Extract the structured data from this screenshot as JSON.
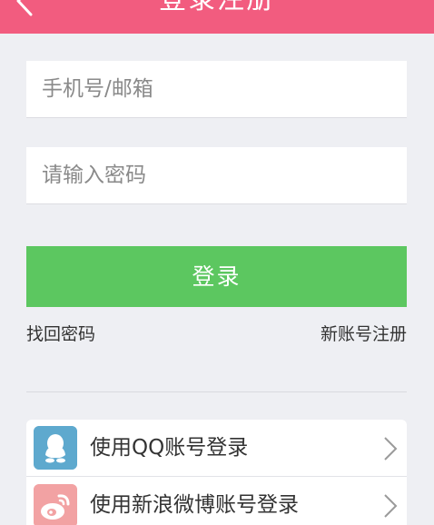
{
  "header": {
    "title": "登录注册",
    "back_icon": "chevron-left-icon",
    "color": "#f25c7f"
  },
  "form": {
    "account_placeholder": "手机号/邮箱",
    "password_placeholder": "请输入密码",
    "login_label": "登录",
    "login_color": "#5cc760"
  },
  "links": {
    "forgot": "找回密码",
    "register": "新账号注册"
  },
  "social": {
    "items": [
      {
        "label": "使用QQ账号登录",
        "icon": "qq-icon"
      },
      {
        "label": "使用新浪微博账号登录",
        "icon": "weibo-icon"
      }
    ]
  }
}
